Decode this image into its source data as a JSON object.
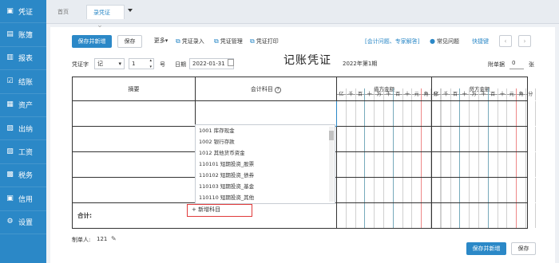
{
  "sidebar": {
    "items": [
      {
        "icon": "voucher-icon",
        "glyph": "▣",
        "label": "凭证"
      },
      {
        "icon": "ledger-icon",
        "glyph": "▤",
        "label": "账簿"
      },
      {
        "icon": "report-icon",
        "glyph": "▥",
        "label": "报表"
      },
      {
        "icon": "checkout-icon",
        "glyph": "☑",
        "label": "结账"
      },
      {
        "icon": "assets-icon",
        "glyph": "▦",
        "label": "资产"
      },
      {
        "icon": "cashier-icon",
        "glyph": "▧",
        "label": "出纳"
      },
      {
        "icon": "salary-icon",
        "glyph": "▨",
        "label": "工资"
      },
      {
        "icon": "tax-icon",
        "glyph": "▩",
        "label": "税务"
      },
      {
        "icon": "credit-icon",
        "glyph": "▣",
        "label": "信用"
      },
      {
        "icon": "settings-icon",
        "glyph": "⚙",
        "label": "设置"
      }
    ]
  },
  "tabs": {
    "home": "首页",
    "active": "录凭证",
    "close_glyph": "×"
  },
  "toolbar": {
    "save_new": "保存并新增",
    "save": "保存",
    "more": "更多",
    "more_caret": "▾",
    "entry": "凭证录入",
    "manage": "凭证管理",
    "print": "凭证打印",
    "help_link": "[会计问题、专家解答]",
    "faq": "常见问题",
    "shortcut": "快捷键",
    "prev_glyph": "‹",
    "next_glyph": "›"
  },
  "voucher": {
    "word_label": "凭证字",
    "word_value": "记",
    "number_value": "1",
    "number_unit": "号",
    "date_label": "日期",
    "date_value": "2022-01-31",
    "title": "记账凭证",
    "period": "2022年第1期",
    "attachment_label": "附单据",
    "attachment_value": "0",
    "attachment_unit": "张"
  },
  "table": {
    "col_summary": "摘要",
    "col_subject": "会计科目",
    "col_debit": "借方金额",
    "col_credit": "贷方金额",
    "digits": [
      "亿",
      "千",
      "百",
      "十",
      "万",
      "千",
      "百",
      "十",
      "元",
      "角",
      "分"
    ],
    "total_label": "合计:"
  },
  "dropdown": {
    "items": [
      "1001 库存现金",
      "1002 银行存款",
      "1012 其他货币资金",
      "110101 短期投资_股票",
      "110102 短期投资_债券",
      "110103 短期投资_基金",
      "110110 短期投资_其他"
    ],
    "add_label": "+ 新增科目"
  },
  "footer": {
    "maker_label": "制单人:",
    "maker_value": "121",
    "save_new": "保存并新增",
    "save": "保存"
  }
}
